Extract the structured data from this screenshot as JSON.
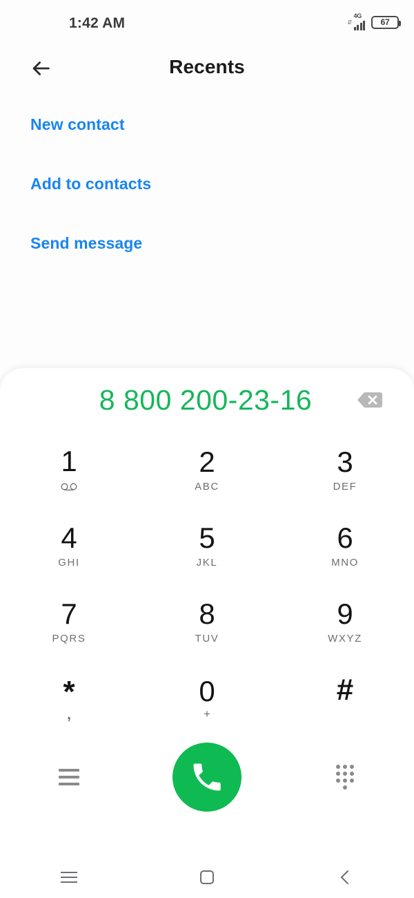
{
  "status_bar": {
    "time": "1:42 AM",
    "network_type": "4G",
    "battery_level": "67",
    "signal_icon": "signal-bars-icon",
    "data_arrows_icon": "data-transfer-arrows-icon",
    "battery_icon": "battery-icon"
  },
  "header": {
    "title": "Recents",
    "back_icon": "back-arrow-icon"
  },
  "actions": [
    {
      "label": "New contact"
    },
    {
      "label": "Add to contacts"
    },
    {
      "label": "Send message"
    }
  ],
  "dialer": {
    "number": "8 800 200-23-16",
    "backspace_icon": "backspace-delete-icon",
    "keys": [
      {
        "digit": "1",
        "sub": "",
        "icon": "voicemail-icon"
      },
      {
        "digit": "2",
        "sub": "ABC",
        "icon": ""
      },
      {
        "digit": "3",
        "sub": "DEF",
        "icon": ""
      },
      {
        "digit": "4",
        "sub": "GHI",
        "icon": ""
      },
      {
        "digit": "5",
        "sub": "JKL",
        "icon": ""
      },
      {
        "digit": "6",
        "sub": "MNO",
        "icon": ""
      },
      {
        "digit": "7",
        "sub": "PQRS",
        "icon": ""
      },
      {
        "digit": "8",
        "sub": "TUV",
        "icon": ""
      },
      {
        "digit": "9",
        "sub": "WXYZ",
        "icon": ""
      },
      {
        "digit": "*",
        "sub": ",",
        "icon": ""
      },
      {
        "digit": "0",
        "sub": "+",
        "icon": ""
      },
      {
        "digit": "#",
        "sub": "",
        "icon": ""
      }
    ],
    "menu_icon": "hamburger-menu-icon",
    "call_icon": "phone-handset-icon",
    "keypad_icon": "dialpad-dots-icon"
  },
  "nav_bar": {
    "recents_icon": "recents-lines-icon",
    "home_icon": "home-square-icon",
    "back_icon": "back-chevron-icon"
  },
  "colors": {
    "accent_green": "#0fba53",
    "number_green": "#16b65a",
    "link_blue": "#1a85f0",
    "icon_gray": "#8a8a8a",
    "nav_gray": "#6c6f73",
    "background": "#ffffff"
  }
}
